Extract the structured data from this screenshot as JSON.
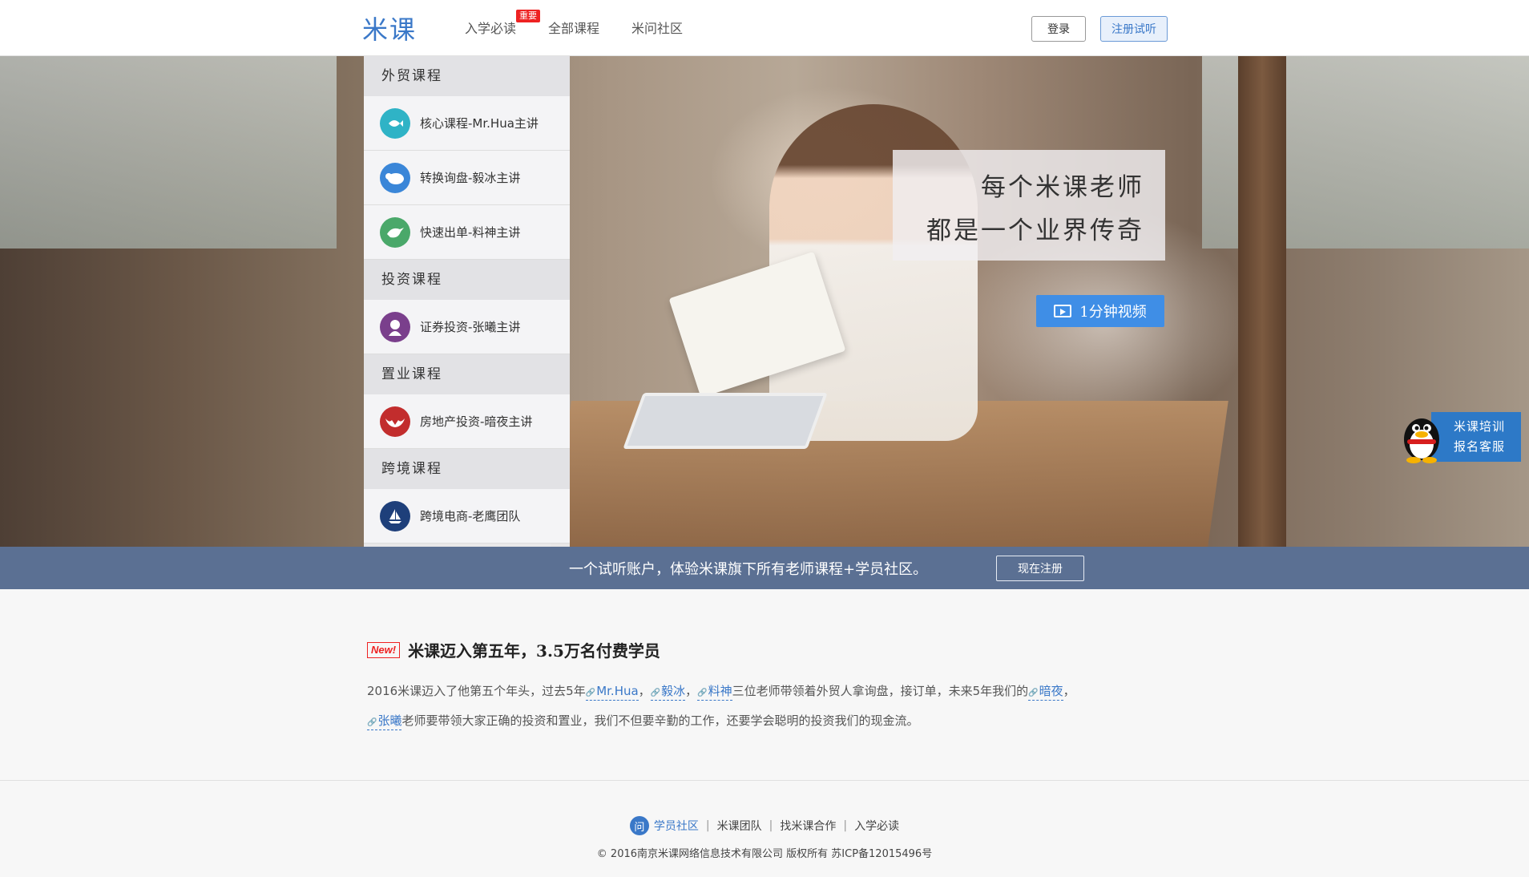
{
  "header": {
    "logo": "米课",
    "nav": [
      {
        "label": "入学必读",
        "badge": "重要"
      },
      {
        "label": "全部课程"
      },
      {
        "label": "米问社区"
      }
    ],
    "login": "登录",
    "register": "注册试听"
  },
  "sidebar": {
    "categories": [
      {
        "title": "外贸课程",
        "courses": [
          {
            "label": "核心课程-Mr.Hua主讲",
            "icon": "fish-icon",
            "color": "#2fb3c6"
          },
          {
            "label": "转换询盘-毅冰主讲",
            "icon": "bear-icon",
            "color": "#3a86d8"
          },
          {
            "label": "快速出单-料神主讲",
            "icon": "bird-icon",
            "color": "#4aa86a"
          }
        ]
      },
      {
        "title": "投资课程",
        "courses": [
          {
            "label": "证券投资-张曦主讲",
            "icon": "lady-icon",
            "color": "#7a3f8c"
          }
        ]
      },
      {
        "title": "置业课程",
        "courses": [
          {
            "label": "房地产投资-暗夜主讲",
            "icon": "bat-icon",
            "color": "#c22d2d"
          }
        ]
      },
      {
        "title": "跨境课程",
        "courses": [
          {
            "label": "跨境电商-老鹰团队",
            "icon": "sailboat-icon",
            "color": "#1e3f7a"
          }
        ]
      }
    ]
  },
  "hero": {
    "slogan_line1": "每个米课老师",
    "slogan_line2": "都是一个业界传奇",
    "video_button": "1分钟视频"
  },
  "qq_service": {
    "line1": "米课培训",
    "line2": "报名客服"
  },
  "strip": {
    "text": "一个试听账户，体验米课旗下所有老师课程+学员社区。",
    "button": "现在注册"
  },
  "news": {
    "badge": "New!",
    "title": "米课迈入第五年，3.5万名付费学员",
    "p1_a": "2016米课迈入了他第五个年头，过去5年",
    "link1": "Mr.Hua",
    "sep1": "，",
    "link2": "毅冰",
    "sep2": "，",
    "link3": "料神",
    "p1_b": "三位老师带领着外贸人拿询盘，接订单，未来5年我们的",
    "link4": "暗夜",
    "sep3": "，",
    "link5": "张曦",
    "p2": "老师要带领大家正确的投资和置业，我们不但要辛勤的工作，还要学会聪明的投资我们的现金流。"
  },
  "footer": {
    "community_icon": "问",
    "community": "学员社区",
    "team": "米课团队",
    "cooperate": "找米课合作",
    "guide": "入学必读",
    "sep": "|",
    "copyright": "© 2016南京米课网络信息技术有限公司 版权所有 苏ICP备12015496号"
  }
}
